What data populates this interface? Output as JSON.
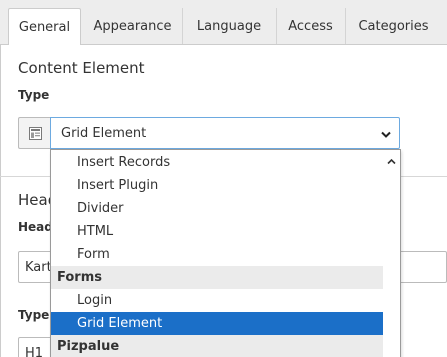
{
  "tabs": [
    {
      "label": "General",
      "active": true
    },
    {
      "label": "Appearance",
      "active": false
    },
    {
      "label": "Language",
      "active": false
    },
    {
      "label": "Access",
      "active": false
    },
    {
      "label": "Categories",
      "active": false
    }
  ],
  "content_element": {
    "title": "Content Element",
    "type_label": "Type",
    "type_value": "Grid Element"
  },
  "header_section": {
    "title_partial": "Head",
    "header_label_partial": "Head",
    "header_value_partial": "Kart",
    "type_label_partial": "Type",
    "type_value_partial": "H1"
  },
  "dropdown": {
    "options": [
      {
        "label": "Insert Records",
        "kind": "option"
      },
      {
        "label": "Insert Plugin",
        "kind": "option"
      },
      {
        "label": "Divider",
        "kind": "option"
      },
      {
        "label": "HTML",
        "kind": "option"
      },
      {
        "label": "Form",
        "kind": "option"
      },
      {
        "label": "Forms",
        "kind": "group"
      },
      {
        "label": "Login",
        "kind": "option"
      },
      {
        "label": "Grid Element",
        "kind": "selected"
      },
      {
        "label": "Pizpalue",
        "kind": "group"
      }
    ]
  },
  "colors": {
    "selected_bg": "#1b6fc8",
    "focus_border": "#6daae0",
    "tabbar_bg": "#ededed"
  },
  "icons": {
    "type_icon": "content-element-icon",
    "select_arrow": "chevron-down-icon",
    "scroll_up": "chevron-up-icon"
  }
}
